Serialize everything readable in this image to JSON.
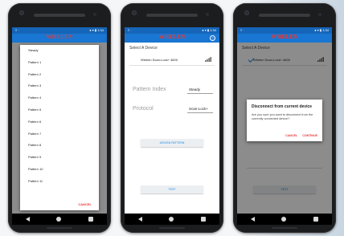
{
  "app": {
    "logo_text": "WHELEN",
    "logo_subtext": "ENGINEERING",
    "status_left": "≡ ·",
    "status_right": "● ▾ ▮ 1:34",
    "help_icon": "?"
  },
  "phone1": {
    "bg_items": [
      "Select A Device",
      "",
      "Pattern Index",
      "Protocol"
    ],
    "patterns": [
      "Steady",
      "Pattern 1",
      "Pattern 2",
      "Pattern 3",
      "Pattern 4",
      "Pattern 5",
      "Pattern 6",
      "Pattern 7",
      "Pattern 8",
      "Pattern 9",
      "Pattern 10",
      "Pattern 11"
    ],
    "cancel_label": "CANCEL"
  },
  "phone2": {
    "section_title": "Select A Device",
    "device_name": "Whelen Scan-Lock+ 4600",
    "pattern_label": "Pattern Index",
    "pattern_value": "Steady",
    "protocol_label": "Protocol",
    "protocol_value": "Scan-Lock+",
    "assign_button": "ASSIGN PATTERN",
    "test_button": "TEST"
  },
  "phone3": {
    "section_title": "Select A Device",
    "device_name": "Whelen Scan-Lock+ 4600",
    "dialog_title": "Disconnect from current device",
    "dialog_body": "Are you sure you want to disconnect from the currently connected device?",
    "cancel_label": "CANCEL",
    "continue_label": "CONTINUE",
    "assign_button": "ASSIGN PATTERN",
    "test_button": "TEST"
  },
  "colors": {
    "app_bar": "#1976d2",
    "status_bar": "#1565b8",
    "accent_red": "#e53935",
    "accent_blue": "#1e88e5"
  }
}
